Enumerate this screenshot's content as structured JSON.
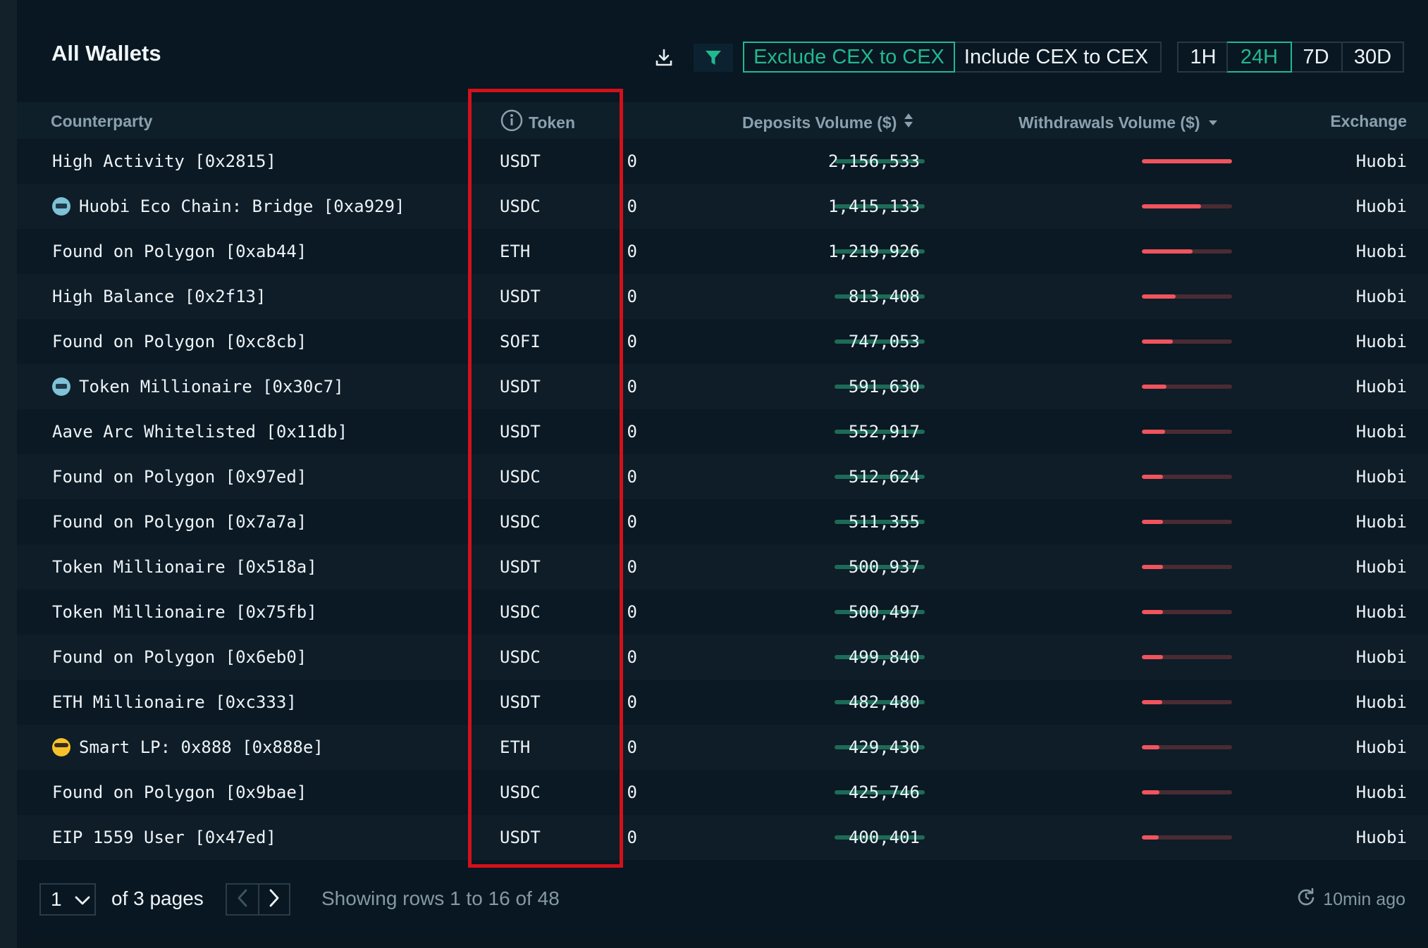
{
  "header": {
    "title": "All Wallets",
    "cex_toggle": [
      "Exclude CEX to CEX",
      "Include CEX to CEX"
    ],
    "cex_active": "Exclude CEX to CEX",
    "timeframes": [
      "1H",
      "24H",
      "7D",
      "30D"
    ],
    "timeframe_active": "24H",
    "icons": [
      "download-icon",
      "filter-icon"
    ]
  },
  "columns": {
    "counterparty": "Counterparty",
    "token": "Token",
    "deposits": "Deposits Volume ($)",
    "withdrawals": "Withdrawals Volume ($)",
    "exchange": "Exchange"
  },
  "rows": [
    {
      "counterparty": "High Activity [0x2815]",
      "emoji": "",
      "token": "USDT",
      "deposits": "0",
      "withdrawals": "2,156,533",
      "withdrawals_share": 1.0,
      "exchange": "Huobi"
    },
    {
      "counterparty": "Huobi Eco Chain: Bridge [0xa929]",
      "emoji": "robot",
      "token": "USDC",
      "deposits": "0",
      "withdrawals": "1,415,133",
      "withdrawals_share": 0.656,
      "exchange": "Huobi"
    },
    {
      "counterparty": "Found on Polygon [0xab44]",
      "emoji": "",
      "token": "ETH",
      "deposits": "0",
      "withdrawals": "1,219,926",
      "withdrawals_share": 0.566,
      "exchange": "Huobi"
    },
    {
      "counterparty": "High Balance [0x2f13]",
      "emoji": "",
      "token": "USDT",
      "deposits": "0",
      "withdrawals": "813,408",
      "withdrawals_share": 0.377,
      "exchange": "Huobi"
    },
    {
      "counterparty": "Found on Polygon [0xc8cb]",
      "emoji": "",
      "token": "SOFI",
      "deposits": "0",
      "withdrawals": "747,053",
      "withdrawals_share": 0.346,
      "exchange": "Huobi"
    },
    {
      "counterparty": "Token Millionaire [0x30c7]",
      "emoji": "robot",
      "token": "USDT",
      "deposits": "0",
      "withdrawals": "591,630",
      "withdrawals_share": 0.274,
      "exchange": "Huobi"
    },
    {
      "counterparty": "Aave Arc Whitelisted [0x11db]",
      "emoji": "",
      "token": "USDT",
      "deposits": "0",
      "withdrawals": "552,917",
      "withdrawals_share": 0.256,
      "exchange": "Huobi"
    },
    {
      "counterparty": "Found on Polygon [0x97ed]",
      "emoji": "",
      "token": "USDC",
      "deposits": "0",
      "withdrawals": "512,624",
      "withdrawals_share": 0.238,
      "exchange": "Huobi"
    },
    {
      "counterparty": "Found on Polygon [0x7a7a]",
      "emoji": "",
      "token": "USDC",
      "deposits": "0",
      "withdrawals": "511,355",
      "withdrawals_share": 0.237,
      "exchange": "Huobi"
    },
    {
      "counterparty": "Token Millionaire [0x518a]",
      "emoji": "",
      "token": "USDT",
      "deposits": "0",
      "withdrawals": "500,937",
      "withdrawals_share": 0.232,
      "exchange": "Huobi"
    },
    {
      "counterparty": "Token Millionaire [0x75fb]",
      "emoji": "",
      "token": "USDC",
      "deposits": "0",
      "withdrawals": "500,497",
      "withdrawals_share": 0.232,
      "exchange": "Huobi"
    },
    {
      "counterparty": "Found on Polygon [0x6eb0]",
      "emoji": "",
      "token": "USDC",
      "deposits": "0",
      "withdrawals": "499,840",
      "withdrawals_share": 0.232,
      "exchange": "Huobi"
    },
    {
      "counterparty": "ETH Millionaire [0xc333]",
      "emoji": "",
      "token": "USDT",
      "deposits": "0",
      "withdrawals": "482,480",
      "withdrawals_share": 0.224,
      "exchange": "Huobi"
    },
    {
      "counterparty": "Smart LP: 0x888 [0x888e]",
      "emoji": "cool",
      "token": "ETH",
      "deposits": "0",
      "withdrawals": "429,430",
      "withdrawals_share": 0.199,
      "exchange": "Huobi"
    },
    {
      "counterparty": "Found on Polygon [0x9bae]",
      "emoji": "",
      "token": "USDC",
      "deposits": "0",
      "withdrawals": "425,746",
      "withdrawals_share": 0.197,
      "exchange": "Huobi"
    },
    {
      "counterparty": "EIP 1559 User [0x47ed]",
      "emoji": "",
      "token": "USDT",
      "deposits": "0",
      "withdrawals": "400,401",
      "withdrawals_share": 0.186,
      "exchange": "Huobi"
    }
  ],
  "footer": {
    "page_value": "1",
    "of_pages": "of 3 pages",
    "showing": "Showing rows 1 to 16 of 48",
    "updated": "10min ago"
  },
  "colors": {
    "accent": "#22b98f",
    "withdraw_bar": "#f0545d",
    "deposit_bar": "#1d6b57",
    "highlight_box": "#d4101a"
  }
}
